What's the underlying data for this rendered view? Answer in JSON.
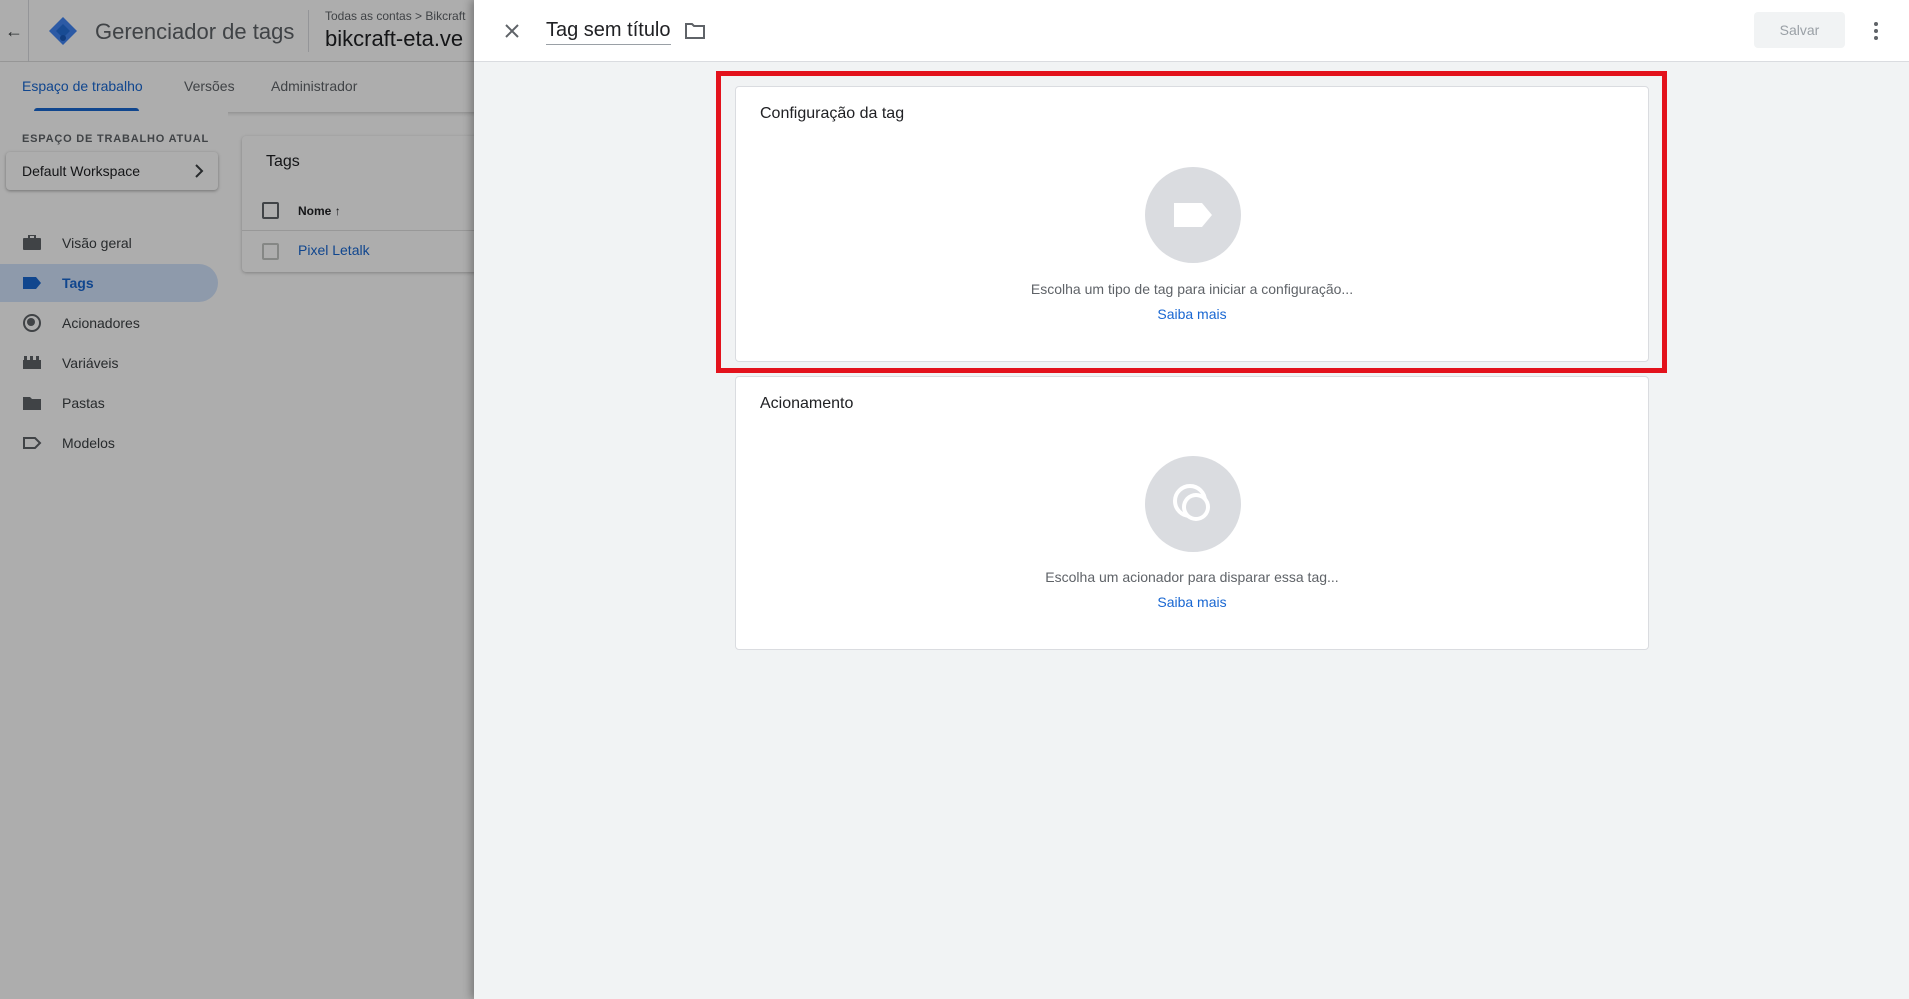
{
  "app": {
    "product_name": "Gerenciador de tags",
    "breadcrumb": "Todas as contas > Bikcraft",
    "container_name": "bikcraft-eta.ve"
  },
  "nav_tabs": [
    {
      "label": "Espaço de trabalho",
      "active": true
    },
    {
      "label": "Versões",
      "active": false
    },
    {
      "label": "Administrador",
      "active": false
    }
  ],
  "sidebar": {
    "workspace_caption": "ESPAÇO DE TRABALHO ATUAL",
    "workspace_name": "Default Workspace",
    "items": [
      {
        "label": "Visão geral",
        "icon": "briefcase-icon"
      },
      {
        "label": "Tags",
        "icon": "tag-icon",
        "active": true
      },
      {
        "label": "Acionadores",
        "icon": "trigger-icon"
      },
      {
        "label": "Variáveis",
        "icon": "variables-icon"
      },
      {
        "label": "Pastas",
        "icon": "folder-icon"
      },
      {
        "label": "Modelos",
        "icon": "template-icon"
      }
    ]
  },
  "tags_list": {
    "title": "Tags",
    "column_name": "Nome",
    "rows": [
      "Pixel Letalk"
    ]
  },
  "sheet": {
    "title": "Tag sem título",
    "save_label": "Salvar",
    "config_card": {
      "title": "Configuração da tag",
      "hint": "Escolha um tipo de tag para iniciar a configuração...",
      "learn_more": "Saiba mais"
    },
    "trigger_card": {
      "title": "Acionamento",
      "hint": "Escolha um acionador para disparar essa tag...",
      "learn_more": "Saiba mais"
    }
  },
  "colors": {
    "accent": "#1967d2",
    "highlight": "#e3121c",
    "nav_active_bg": "#d2e3fc"
  }
}
